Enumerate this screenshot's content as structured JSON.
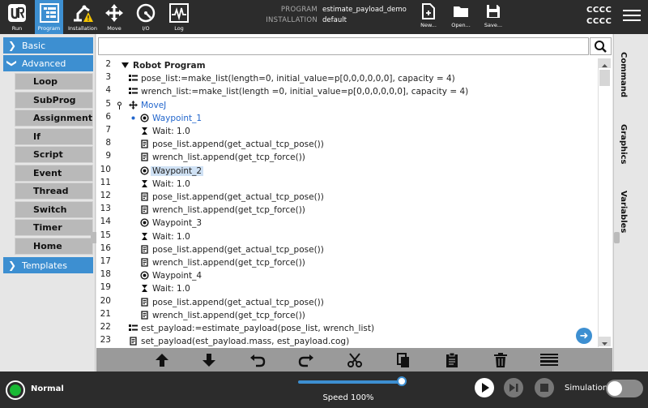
{
  "header": {
    "tabs": [
      {
        "label": "Run"
      },
      {
        "label": "Program"
      },
      {
        "label": "Installation"
      },
      {
        "label": "Move"
      },
      {
        "label": "I/O"
      },
      {
        "label": "Log"
      }
    ],
    "program_key": "PROGRAM",
    "program_value": "estimate_payload_demo",
    "installation_key": "INSTALLATION",
    "installation_value": "default",
    "file_buttons": [
      {
        "label": "New..."
      },
      {
        "label": "Open..."
      },
      {
        "label": "Save..."
      }
    ],
    "robot_name_1": "CCCC",
    "robot_name_2": "CCCC"
  },
  "sidebar": {
    "basic": "Basic",
    "advanced": "Advanced",
    "advanced_items": [
      "Loop",
      "SubProg",
      "Assignment",
      "If",
      "Script",
      "Event",
      "Thread",
      "Switch",
      "Timer",
      "Home"
    ],
    "templates": "Templates"
  },
  "editor": {
    "search_placeholder": "",
    "rows": [
      {
        "n": "2",
        "indent": 0,
        "icon": "collapse",
        "text": "Robot Program",
        "style": "bold"
      },
      {
        "n": "3",
        "indent": 1,
        "icon": "assignment",
        "text": "pose_list:=make_list(length=0, initial_value=p[0,0,0,0,0,0], capacity = 4)"
      },
      {
        "n": "4",
        "indent": 1,
        "icon": "assignment",
        "text": "wrench_list:=make_list(length =0, initial_value=p[0,0,0,0,0,0], capacity = 4)"
      },
      {
        "n": "5",
        "indent": 1,
        "icon": "move",
        "text": "MoveJ",
        "style": "blue"
      },
      {
        "n": "6",
        "indent": 2,
        "icon": "waypoint",
        "text": "Waypoint_1",
        "style": "blue"
      },
      {
        "n": "7",
        "indent": 2,
        "icon": "wait",
        "text": "Wait: 1.0"
      },
      {
        "n": "8",
        "indent": 2,
        "icon": "script",
        "text": "pose_list.append(get_actual_tcp_pose())"
      },
      {
        "n": "9",
        "indent": 2,
        "icon": "script",
        "text": "wrench_list.append(get_tcp_force())"
      },
      {
        "n": "10",
        "indent": 2,
        "icon": "waypoint",
        "text": "Waypoint_2",
        "style": "sel"
      },
      {
        "n": "11",
        "indent": 2,
        "icon": "wait",
        "text": "Wait: 1.0"
      },
      {
        "n": "12",
        "indent": 2,
        "icon": "script",
        "text": "pose_list.append(get_actual_tcp_pose())"
      },
      {
        "n": "13",
        "indent": 2,
        "icon": "script",
        "text": "wrench_list.append(get_tcp_force())"
      },
      {
        "n": "14",
        "indent": 2,
        "icon": "waypoint",
        "text": "Waypoint_3"
      },
      {
        "n": "15",
        "indent": 2,
        "icon": "wait",
        "text": "Wait: 1.0"
      },
      {
        "n": "16",
        "indent": 2,
        "icon": "script",
        "text": "pose_list.append(get_actual_tcp_pose())"
      },
      {
        "n": "17",
        "indent": 2,
        "icon": "script",
        "text": "wrench_list.append(get_tcp_force())"
      },
      {
        "n": "18",
        "indent": 2,
        "icon": "waypoint",
        "text": "Waypoint_4"
      },
      {
        "n": "19",
        "indent": 2,
        "icon": "wait",
        "text": "Wait: 1.0"
      },
      {
        "n": "20",
        "indent": 2,
        "icon": "script",
        "text": "pose_list.append(get_actual_tcp_pose())"
      },
      {
        "n": "21",
        "indent": 2,
        "icon": "script",
        "text": "wrench_list.append(get_tcp_force())"
      },
      {
        "n": "22",
        "indent": 1,
        "icon": "assignment",
        "text": "est_payload:=estimate_payload(pose_list, wrench_list)"
      },
      {
        "n": "23",
        "indent": 1,
        "icon": "script",
        "text": "set_payload(est_payload.mass, est_payload.cog)"
      }
    ]
  },
  "right_tabs": [
    "Command",
    "Graphics",
    "Variables"
  ],
  "footer": {
    "status": "Normal",
    "speed_label": "Speed 100%",
    "speed_value": 1.0,
    "simulation_label": "Simulation"
  },
  "colors": {
    "accent": "#3d8fd1",
    "header_bg": "#2c2c2c",
    "status_ok": "#19b934"
  }
}
